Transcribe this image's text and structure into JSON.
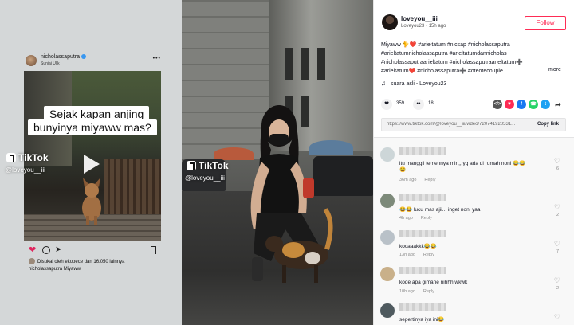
{
  "left": {
    "instagram": {
      "username": "nicholassaputra",
      "location": "Sunjai Ulik",
      "menu": "•••",
      "caption_line1": "Sejak kapan anjing",
      "caption_line2": "bunyinya miyaww mas?",
      "liked_by": "Disukai oleh ekopece dan 16.050 lainnya",
      "post_caption": "nicholassaputra Miyaww"
    },
    "tiktok_watermark": "TikTok",
    "tiktok_handle": "@loveyou__iii"
  },
  "middle": {
    "tiktok_watermark": "TikTok",
    "tiktok_handle": "@loveyou__iii"
  },
  "right": {
    "username": "loveyou__iii",
    "subline": "Loveyou23 · 15h ago",
    "follow_label": "Follow",
    "description": "Miyaww 🐈❤️ #arieltatum #nicsap #nicholassaputra #arieltatumnicholassaputra #arieltatumdannicholas #nicholassaputraarieltatum #nicholassaputraarieltatum➕ #arieltatum❤️ #nicholassaputra➕ #oteotecouple",
    "more_label": "more",
    "music": "suara asli - Loveyou23",
    "likes": "359",
    "comments": "18",
    "link_url": "https://www.tiktok.com/@loveyou__iii/video/720741920531...",
    "copy_label": "Copy link",
    "comment_list": [
      {
        "text": "itu manggil temennya min,, yg ada di rumah noni 😂😂",
        "text2": "😂",
        "time": "36m ago",
        "reply": "Reply",
        "count": "6"
      },
      {
        "text": "😂😂 lucu mas ajii... inget noni yaa",
        "time": "4h ago",
        "reply": "Reply",
        "count": "2"
      },
      {
        "text": "kocaaakkk😂😂",
        "time": "13h ago",
        "reply": "Reply",
        "count": "7"
      },
      {
        "text": "kode apa gimane nihhh wkwk",
        "time": "10h ago",
        "reply": "Reply",
        "count": "2"
      },
      {
        "text": "sepertinya iya ini😂",
        "time": "",
        "reply": "",
        "count": ""
      }
    ]
  },
  "colors": {
    "follow": "#fe2c55",
    "heart": "#e0245e",
    "share_tiktok": "#fe2c55",
    "share_facebook": "#1877f2",
    "share_whatsapp": "#25d366",
    "share_twitter": "#1da1f2"
  }
}
